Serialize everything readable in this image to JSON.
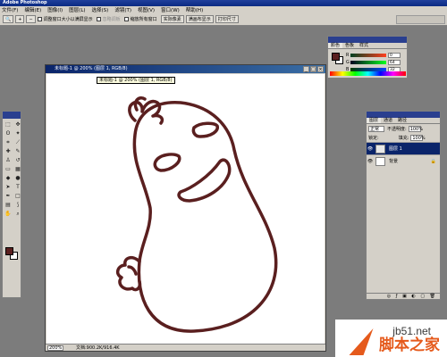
{
  "app": {
    "title": "Adobe Photoshop"
  },
  "menu": [
    "文件(F)",
    "编辑(E)",
    "图像(I)",
    "图层(L)",
    "选择(S)",
    "滤镜(T)",
    "视图(V)",
    "窗口(W)",
    "帮助(H)"
  ],
  "options": {
    "resize_window": "调整窗口大小以满屏显示",
    "ignore_palettes": "忽略调板",
    "zoom_all": "缩放所有窗口",
    "actual_pixels": "实际像素",
    "fit_screen": "满画布显示",
    "print_size": "打印尺寸"
  },
  "document": {
    "title": "未标题-1 @ 200% (图层 1, RGB/8)",
    "tooltip": "未标题-1 @ 200% (图层 1, RGB/8)",
    "zoom": "200%",
    "status": "文档:900.2K/916.4K"
  },
  "color_palette": {
    "tabs": [
      "颜色",
      "色板",
      "样式"
    ],
    "rows": [
      {
        "label": "R",
        "value": "0"
      },
      {
        "label": "G",
        "value": "64"
      },
      {
        "label": "B",
        "value": "32"
      }
    ],
    "foreground": "#5a1f1f",
    "background": "#ffffff"
  },
  "layers_palette": {
    "tabs": [
      "图层",
      "通道",
      "路径"
    ],
    "blend_mode": "正常",
    "opacity_label": "不透明度:",
    "opacity": "100%",
    "lock_label": "锁定:",
    "fill_label": "填充:",
    "fill": "100%",
    "layers": [
      {
        "name": "图层 1",
        "active": true
      },
      {
        "name": "背景",
        "active": false
      }
    ]
  },
  "watermark": {
    "site": "jb51.net",
    "name": "脚本之家"
  },
  "colors": {
    "stroke": "#5a1f1f",
    "workspace": "#7c7c7c",
    "chrome": "#d4d0c8",
    "title": "#0a246a"
  }
}
